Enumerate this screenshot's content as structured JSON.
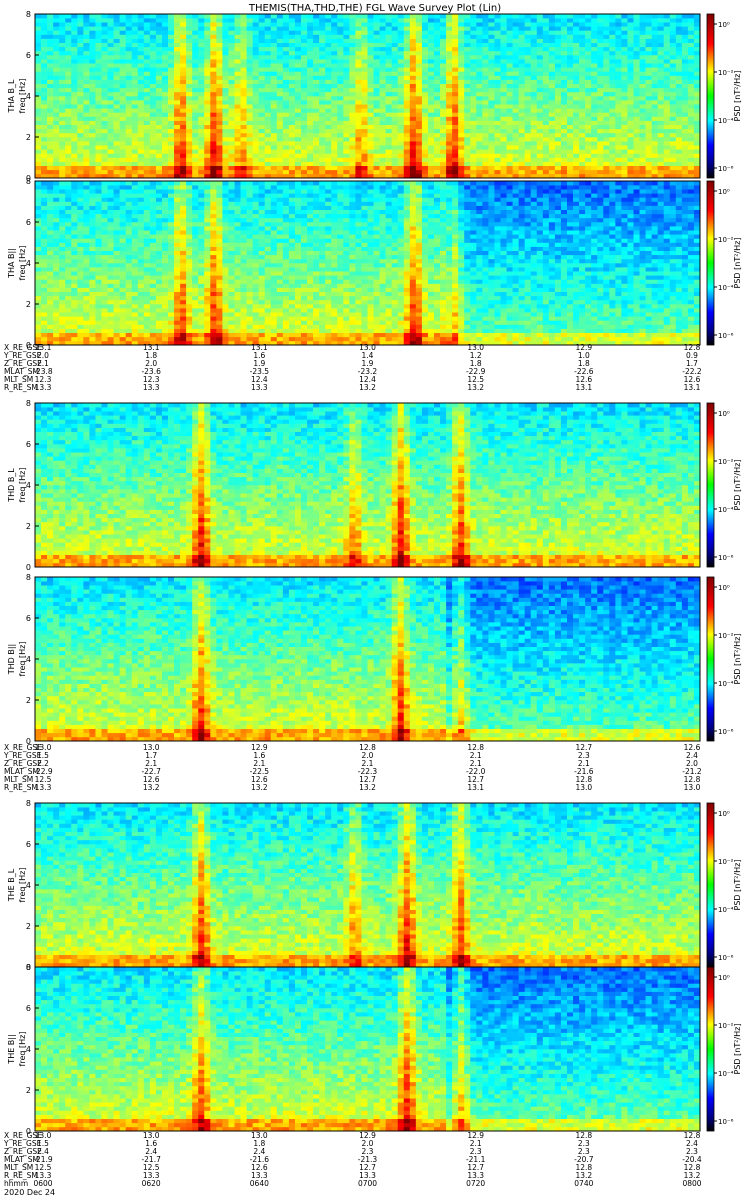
{
  "title": "THEMIS(THA,THD,THE) FGL Wave Survey Plot (Lin)",
  "colors": {
    "background": "#ffffff",
    "axis": "#000000"
  },
  "colorbar_ticks": [
    "10⁰",
    "10⁻²",
    "10⁻⁴",
    "10⁻⁶"
  ],
  "colorbar_label": "PSD [nT²/Hz]",
  "chart_data": {
    "type": "heatmap",
    "x_range": [
      "0600",
      "0800"
    ],
    "y_range": [
      0,
      8
    ],
    "y_ticks": [
      "0",
      "2",
      "4",
      "6",
      "8"
    ],
    "panels": [
      {
        "probe": "THA",
        "component": "B_L",
        "label": "THA B_L",
        "ylabel": "freq [Hz]",
        "bursts": [
          {
            "t": 0.22,
            "s": 0.8
          },
          {
            "t": 0.27,
            "s": 0.9
          },
          {
            "t": 0.31,
            "s": 0.5
          },
          {
            "t": 0.49,
            "s": 0.5
          },
          {
            "t": 0.57,
            "s": 0.9
          },
          {
            "t": 0.63,
            "s": 0.8
          }
        ]
      },
      {
        "probe": "THA",
        "component": "B_||",
        "label": "THA B||",
        "ylabel": "freq [Hz]",
        "bursts": [
          {
            "t": 0.22,
            "s": 0.7
          },
          {
            "t": 0.27,
            "s": 0.8
          },
          {
            "t": 0.57,
            "s": 0.8
          },
          {
            "t": 0.63,
            "s": 0.7
          }
        ]
      },
      {
        "probe": "THD",
        "component": "B_L",
        "label": "THD B_L",
        "ylabel": "freq [Hz]",
        "bursts": [
          {
            "t": 0.25,
            "s": 0.9
          },
          {
            "t": 0.48,
            "s": 0.5
          },
          {
            "t": 0.55,
            "s": 0.9
          },
          {
            "t": 0.64,
            "s": 0.8
          }
        ]
      },
      {
        "probe": "THD",
        "component": "B_||",
        "label": "THD B||",
        "ylabel": "freq [Hz]",
        "bursts": [
          {
            "t": 0.25,
            "s": 0.8
          },
          {
            "t": 0.55,
            "s": 0.8
          },
          {
            "t": 0.64,
            "s": 0.6
          }
        ]
      },
      {
        "probe": "THE",
        "component": "B_L",
        "label": "THE B_L",
        "ylabel": "freq [Hz]",
        "bursts": [
          {
            "t": 0.25,
            "s": 0.8
          },
          {
            "t": 0.48,
            "s": 0.5
          },
          {
            "t": 0.56,
            "s": 0.9
          },
          {
            "t": 0.64,
            "s": 0.8
          }
        ]
      },
      {
        "probe": "THE",
        "component": "B_||",
        "label": "THE B||",
        "ylabel": "freq [Hz]",
        "bursts": [
          {
            "t": 0.25,
            "s": 0.7
          },
          {
            "t": 0.56,
            "s": 0.8
          },
          {
            "t": 0.64,
            "s": 0.7
          }
        ]
      }
    ],
    "ephemeris": [
      {
        "probe": "THA",
        "rows": [
          {
            "label": "X_RE_GSE",
            "values": [
              "13.1",
              "13.1",
              "13.1",
              "13.0",
              "13.0",
              "12.9",
              "12.8"
            ]
          },
          {
            "label": "Y_RE_GSE",
            "values": [
              "2.0",
              "1.8",
              "1.6",
              "1.4",
              "1.2",
              "1.0",
              "0.9"
            ]
          },
          {
            "label": "Z_RE_GSE",
            "values": [
              "2.1",
              "2.0",
              "1.9",
              "1.9",
              "1.8",
              "1.8",
              "1.7"
            ]
          },
          {
            "label": "MLAT_SM",
            "values": [
              "-23.8",
              "-23.6",
              "-23.5",
              "-23.2",
              "-22.9",
              "-22.6",
              "-22.2"
            ]
          },
          {
            "label": "MLT_SM",
            "values": [
              "12.3",
              "12.3",
              "12.4",
              "12.4",
              "12.5",
              "12.6",
              "12.6"
            ]
          },
          {
            "label": "R_RE_SM",
            "values": [
              "13.3",
              "13.3",
              "13.3",
              "13.2",
              "13.2",
              "13.1",
              "13.1"
            ]
          }
        ]
      },
      {
        "probe": "THD",
        "rows": [
          {
            "label": "X_RE_GSE",
            "values": [
              "13.0",
              "13.0",
              "12.9",
              "12.8",
              "12.8",
              "12.7",
              "12.6"
            ]
          },
          {
            "label": "Y_RE_GSE",
            "values": [
              "1.5",
              "1.7",
              "1.6",
              "2.0",
              "2.1",
              "2.3",
              "2.4"
            ]
          },
          {
            "label": "Z_RE_GSE",
            "values": [
              "2.2",
              "2.1",
              "2.1",
              "2.1",
              "2.1",
              "2.1",
              "2.0"
            ]
          },
          {
            "label": "MLAT_SM",
            "values": [
              "-22.9",
              "-22.7",
              "-22.5",
              "-22.3",
              "-22.0",
              "-21.6",
              "-21.2"
            ]
          },
          {
            "label": "MLT_SM",
            "values": [
              "12.5",
              "12.6",
              "12.6",
              "12.7",
              "12.7",
              "12.8",
              "12.8"
            ]
          },
          {
            "label": "R_RE_SM",
            "values": [
              "13.3",
              "13.2",
              "13.2",
              "13.2",
              "13.1",
              "13.0",
              "13.0"
            ]
          }
        ]
      },
      {
        "probe": "THE",
        "rows": [
          {
            "label": "X_RE_GSE",
            "values": [
              "13.0",
              "13.0",
              "13.0",
              "12.9",
              "12.9",
              "12.8",
              "12.8"
            ]
          },
          {
            "label": "Y_RE_GSE",
            "values": [
              "1.5",
              "1.6",
              "1.8",
              "2.0",
              "2.1",
              "2.3",
              "2.4"
            ]
          },
          {
            "label": "Z_RE_GSE",
            "values": [
              "2.4",
              "2.4",
              "2.4",
              "2.3",
              "2.3",
              "2.3",
              "2.3"
            ]
          },
          {
            "label": "MLAT_SM",
            "values": [
              "-21.9",
              "-21.7",
              "-21.6",
              "-21.3",
              "-21.1",
              "-20.7",
              "-20.4"
            ]
          },
          {
            "label": "MLT_SM",
            "values": [
              "12.5",
              "12.5",
              "12.6",
              "12.7",
              "12.7",
              "12.8",
              "12.8"
            ]
          },
          {
            "label": "R_RE_SM",
            "values": [
              "13.3",
              "13.3",
              "13.3",
              "13.3",
              "13.3",
              "13.2",
              "13.2"
            ]
          },
          {
            "label": "hhmm",
            "values": [
              "0600",
              "0620",
              "0640",
              "0700",
              "0720",
              "0740",
              "0800"
            ]
          }
        ]
      }
    ],
    "date": "2020 Dec 24"
  }
}
